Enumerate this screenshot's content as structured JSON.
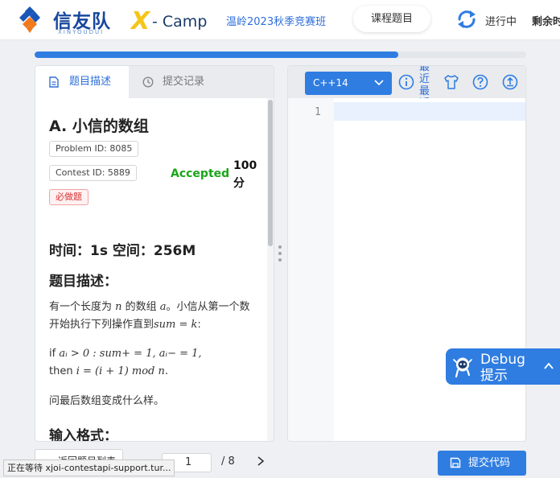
{
  "header": {
    "brand_cn": "信友队",
    "brand_sub": "XINYOUDUI",
    "xcamp_x": "X",
    "xcamp_text": "- Camp",
    "contest_name": "温岭2023秋季竞赛班",
    "course_button": "课程题目",
    "status": "进行中",
    "remaining": "剩余时"
  },
  "progress": {
    "value": 0.74
  },
  "tabs": [
    {
      "label": "题目描述",
      "icon": "document-icon",
      "active": true
    },
    {
      "label": "提交记录",
      "icon": "clock-icon",
      "active": false
    }
  ],
  "problem": {
    "title": "A.  小信的数组",
    "problem_id": "Problem ID: 8085",
    "contest_id": "Contest ID: 5889",
    "required_tag": "必做题",
    "result": "Accepted",
    "score": "100 分",
    "limits": "时间：1s 空间：256M",
    "desc_heading": "题目描述：",
    "p1_a": "有一个长度为 ",
    "p1_n": "n",
    "p1_b": " 的数组 ",
    "p1_arr": "a",
    "p1_c": "。小信从第一个数开始执行下列操作直到",
    "p1_cond": "sum = k",
    "p1_d": ":",
    "p2_if": "if ",
    "p2_cond": "aᵢ > 0 : sum+ = 1, aᵢ− = 1,",
    "p2_then": "then ",
    "p2_expr": "i = (i + 1) mod n",
    "p2_end": ".",
    "p3": "问最后数组变成什么样。",
    "input_heading": "输入格式："
  },
  "editor": {
    "language": "C++14",
    "recent_label": "最近最近代",
    "line_number": "1",
    "tools": [
      "info-icon",
      "shirt-icon",
      "help-icon",
      "upload-icon"
    ]
  },
  "bottom": {
    "list_button": "返回题目列表",
    "page_current": "1",
    "page_total": "/  8",
    "submit": "提交代码"
  },
  "statusbar": "正在等待 xjoi-contestapi-support.tur...",
  "debug": {
    "line1": "Debug",
    "line2": "提示"
  },
  "colors": {
    "accent": "#2f7de1",
    "accepted": "#1aa51a",
    "required": "#d33333"
  }
}
